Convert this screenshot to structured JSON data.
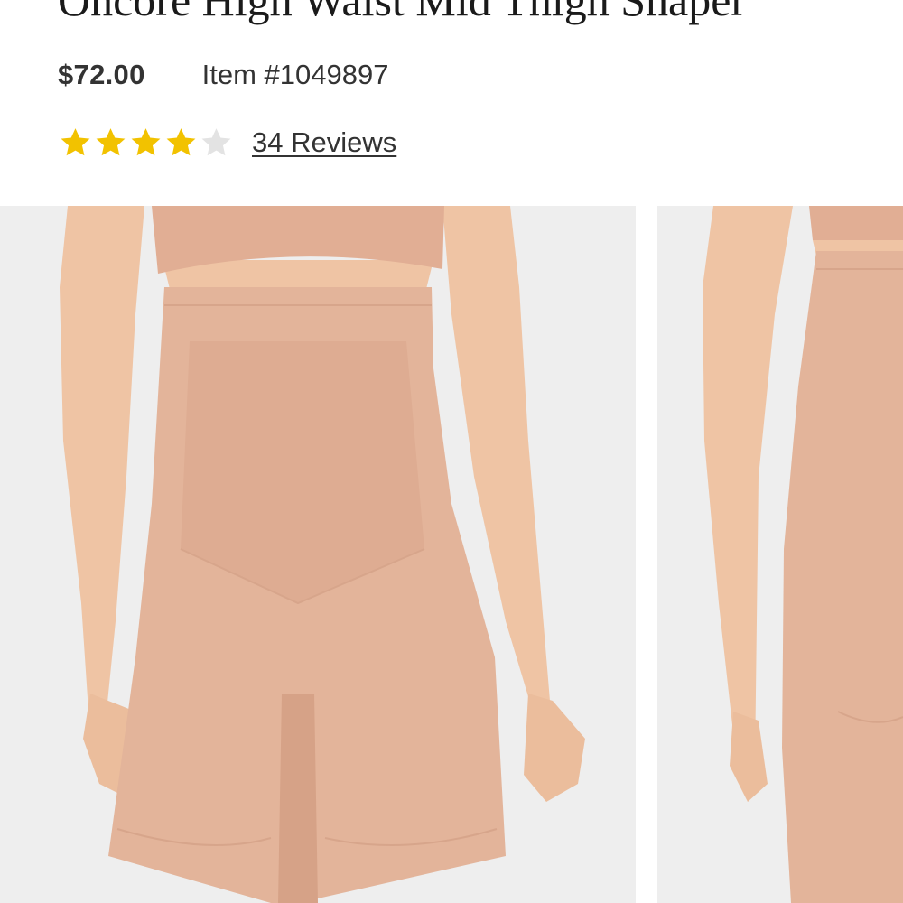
{
  "product": {
    "title": "Oncore High Waist Mid Thigh Shaper",
    "price": "$72.00",
    "item_number": "Item #1049897"
  },
  "rating": {
    "value": 4,
    "max": 5,
    "reviews_link": "34 Reviews",
    "filled_color": "#f2c200",
    "empty_color": "#e3e3e3"
  },
  "gallery": {
    "images": [
      {
        "view": "front",
        "icon": "product-photo-front"
      },
      {
        "view": "back",
        "icon": "product-photo-back"
      }
    ],
    "colors": {
      "background": "#eeeeee",
      "skin": "#efc4a4",
      "garment": "#e3b49a"
    }
  }
}
